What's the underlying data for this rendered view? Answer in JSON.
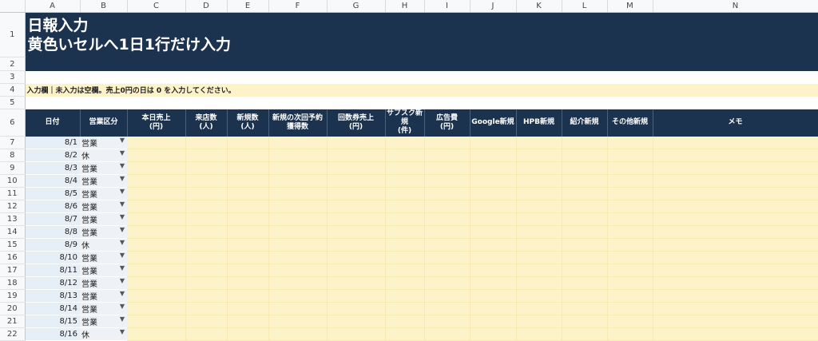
{
  "columns": [
    "A",
    "B",
    "C",
    "D",
    "E",
    "F",
    "G",
    "H",
    "I",
    "J",
    "K",
    "L",
    "M",
    "N"
  ],
  "title_line1": "日報入力",
  "title_line2": "黄色いセルへ1日1行だけ入力",
  "note": "入力欄｜未入力は空欄。売上0円の日は 0 を入力してください。",
  "headers": [
    "日付",
    "営業区分",
    "本日売上\n(円)",
    "来店数\n(人)",
    "新規数\n(人)",
    "新規の次回予約\n獲得数",
    "回数券売上\n(円)",
    "サブスク新規\n(件)",
    "広告費\n(円)",
    "Google新規",
    "HPB新規",
    "紹介新規",
    "その他新規",
    "メモ"
  ],
  "dropdown_icon": "triangle-down-icon",
  "rows": [
    {
      "row": "7",
      "date": "8/1",
      "kbn": "営業"
    },
    {
      "row": "8",
      "date": "8/2",
      "kbn": "休"
    },
    {
      "row": "9",
      "date": "8/3",
      "kbn": "営業"
    },
    {
      "row": "10",
      "date": "8/4",
      "kbn": "営業"
    },
    {
      "row": "11",
      "date": "8/5",
      "kbn": "営業"
    },
    {
      "row": "12",
      "date": "8/6",
      "kbn": "営業"
    },
    {
      "row": "13",
      "date": "8/7",
      "kbn": "営業"
    },
    {
      "row": "14",
      "date": "8/8",
      "kbn": "営業"
    },
    {
      "row": "15",
      "date": "8/9",
      "kbn": "休"
    },
    {
      "row": "16",
      "date": "8/10",
      "kbn": "営業"
    },
    {
      "row": "17",
      "date": "8/11",
      "kbn": "営業"
    },
    {
      "row": "18",
      "date": "8/12",
      "kbn": "営業"
    },
    {
      "row": "19",
      "date": "8/13",
      "kbn": "営業"
    },
    {
      "row": "20",
      "date": "8/14",
      "kbn": "営業"
    },
    {
      "row": "21",
      "date": "8/15",
      "kbn": "営業"
    },
    {
      "row": "22",
      "date": "8/16",
      "kbn": "休"
    }
  ],
  "colors": {
    "header_navy": "#1c3350",
    "input_yellow": "#fdf3c8",
    "date_blue": "#e6eef8"
  }
}
